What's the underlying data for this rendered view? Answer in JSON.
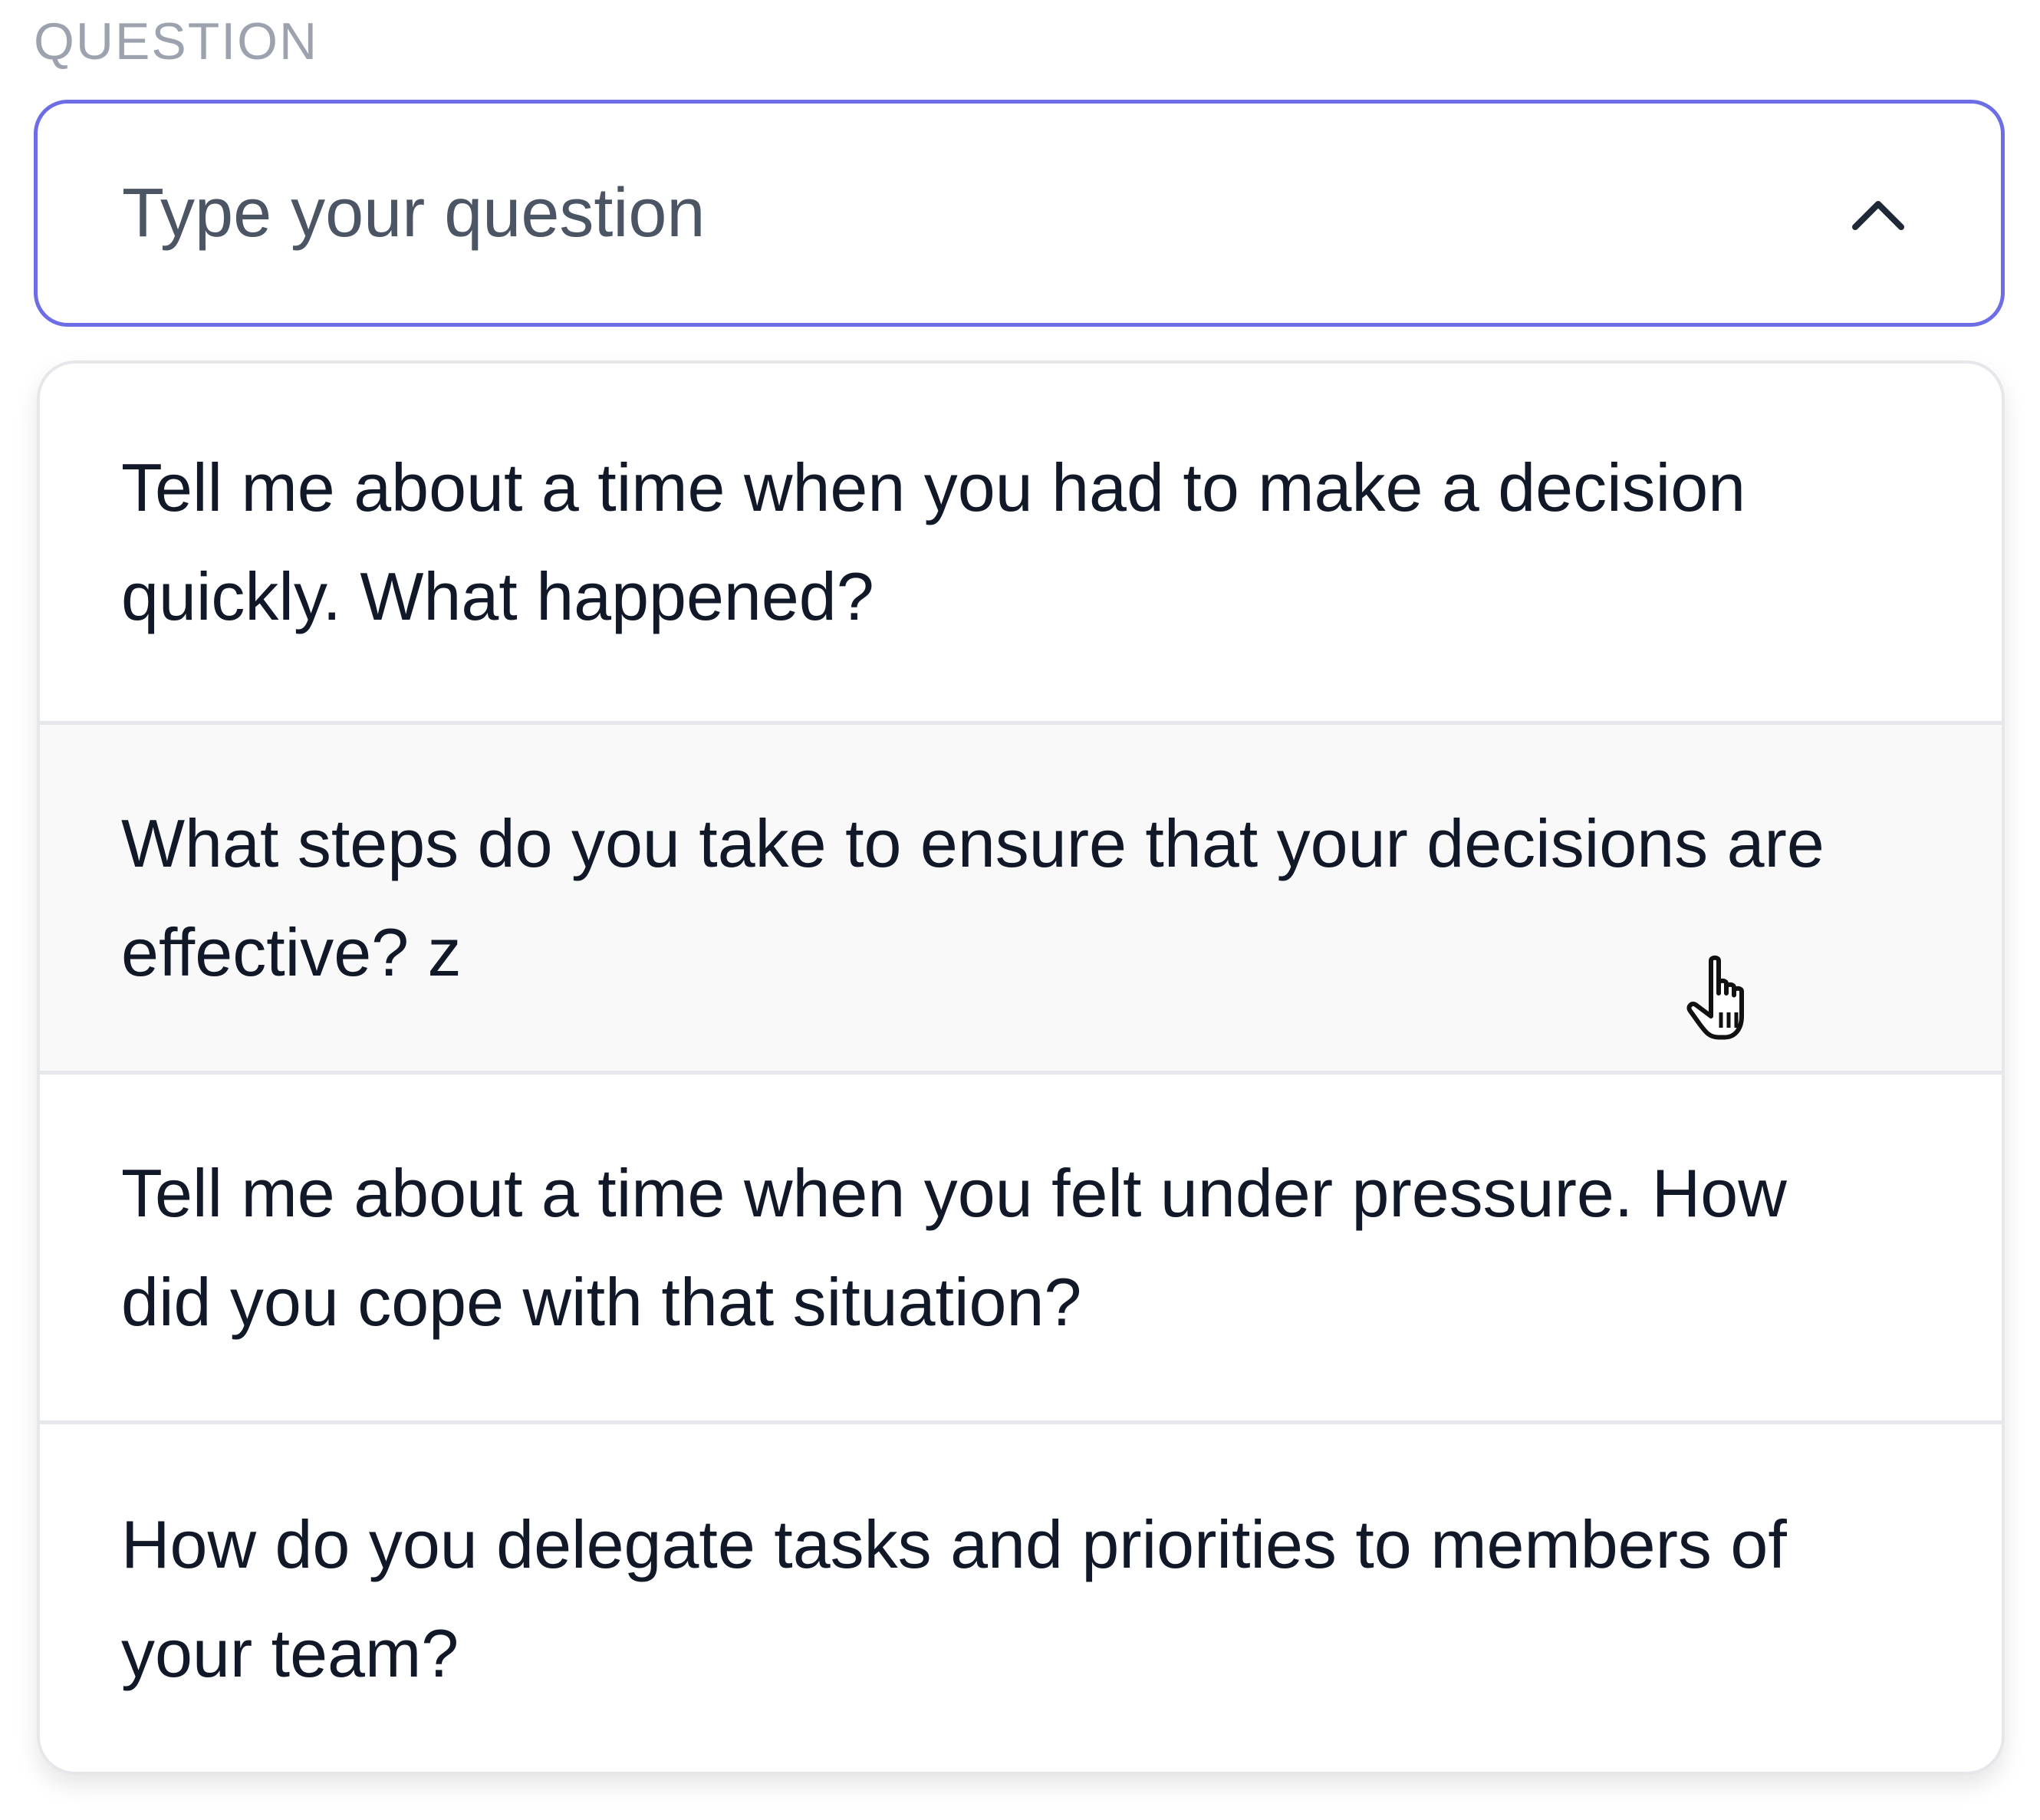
{
  "field": {
    "label": "QUESTION",
    "placeholder": "Type your question",
    "expanded_icon": "chevron-up-icon",
    "border_color": "#6d6ee6"
  },
  "options": [
    {
      "text": "Tell me about a time when you had to make a decision quickly. What happened?",
      "hovered": false
    },
    {
      "text": "What steps do you take to ensure that your decisions are effective? z",
      "hovered": true
    },
    {
      "text": "Tell me about a time when you felt under pressure. How did you cope with that situation?",
      "hovered": false
    },
    {
      "text": "How do you delegate tasks and priorities to members of your team?",
      "hovered": false
    }
  ],
  "cursor": {
    "icon": "hand-pointer-icon"
  }
}
